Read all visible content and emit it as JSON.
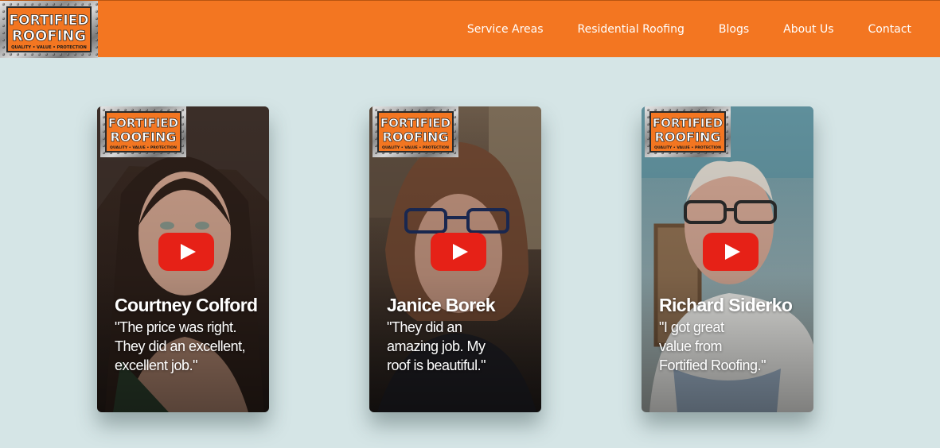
{
  "header": {
    "logo": {
      "line1": "FORTIFIED",
      "line2": "ROOFING",
      "tagline": "QUALITY • VALUE • PROTECTION"
    },
    "nav": [
      {
        "label": "Service Areas"
      },
      {
        "label": "Residential Roofing"
      },
      {
        "label": "Blogs"
      },
      {
        "label": "About Us"
      },
      {
        "label": "Contact"
      }
    ]
  },
  "testimonials": [
    {
      "name": "Courtney Colford",
      "quote": "\"The price was right.\nThey did an excellent,\nexcellent job.\""
    },
    {
      "name": "Janice Borek",
      "quote": "\"They did an\n amazing  job. My\n roof is beautiful.\""
    },
    {
      "name": "Richard Siderko",
      "quote": "\"I got great\nvalue from\nFortified Roofing.\""
    }
  ],
  "colors": {
    "header_bg": "#f37621",
    "page_bg": "#d5e5e6",
    "play_button": "#e62117",
    "logo_orange": "#f37621"
  },
  "icons": {
    "play": "youtube-play-icon",
    "logo": "fortified-roofing-logo"
  }
}
